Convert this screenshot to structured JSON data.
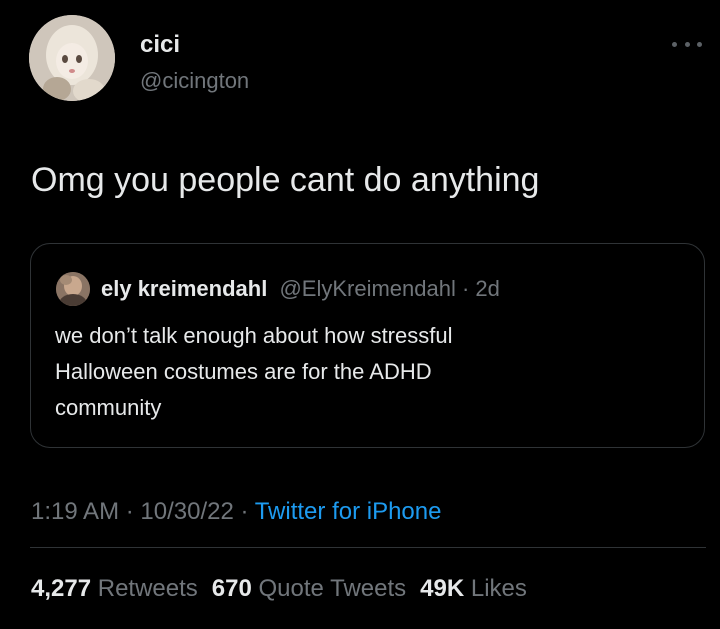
{
  "tweet": {
    "author": {
      "name": "cici",
      "handle": "@cicington"
    },
    "text": "Omg you people cant do anything",
    "more_icon": "more-horizontal-icon"
  },
  "quoted_tweet": {
    "author_name": "ely kreimendahl",
    "author_handle": "@ElyKreimendahl",
    "separator": " · ",
    "age": "2d",
    "text_lines": [
      "we don’t talk enough about how stressful",
      "Halloween costumes are for the ADHD",
      "community"
    ]
  },
  "meta": {
    "time": "1:19 AM",
    "separator": " · ",
    "date": "10/30/22",
    "source": "Twitter for iPhone"
  },
  "stats": {
    "retweets_count": "4,277",
    "retweets_label": "Retweets",
    "quotes_count": "670",
    "quotes_label": "Quote Tweets",
    "likes_count": "49K",
    "likes_label": "Likes"
  },
  "colors": {
    "background": "#000000",
    "primary_text": "#e7e9ea",
    "secondary_text": "#71767b",
    "link": "#1d9bf0",
    "border": "#2f3336"
  }
}
